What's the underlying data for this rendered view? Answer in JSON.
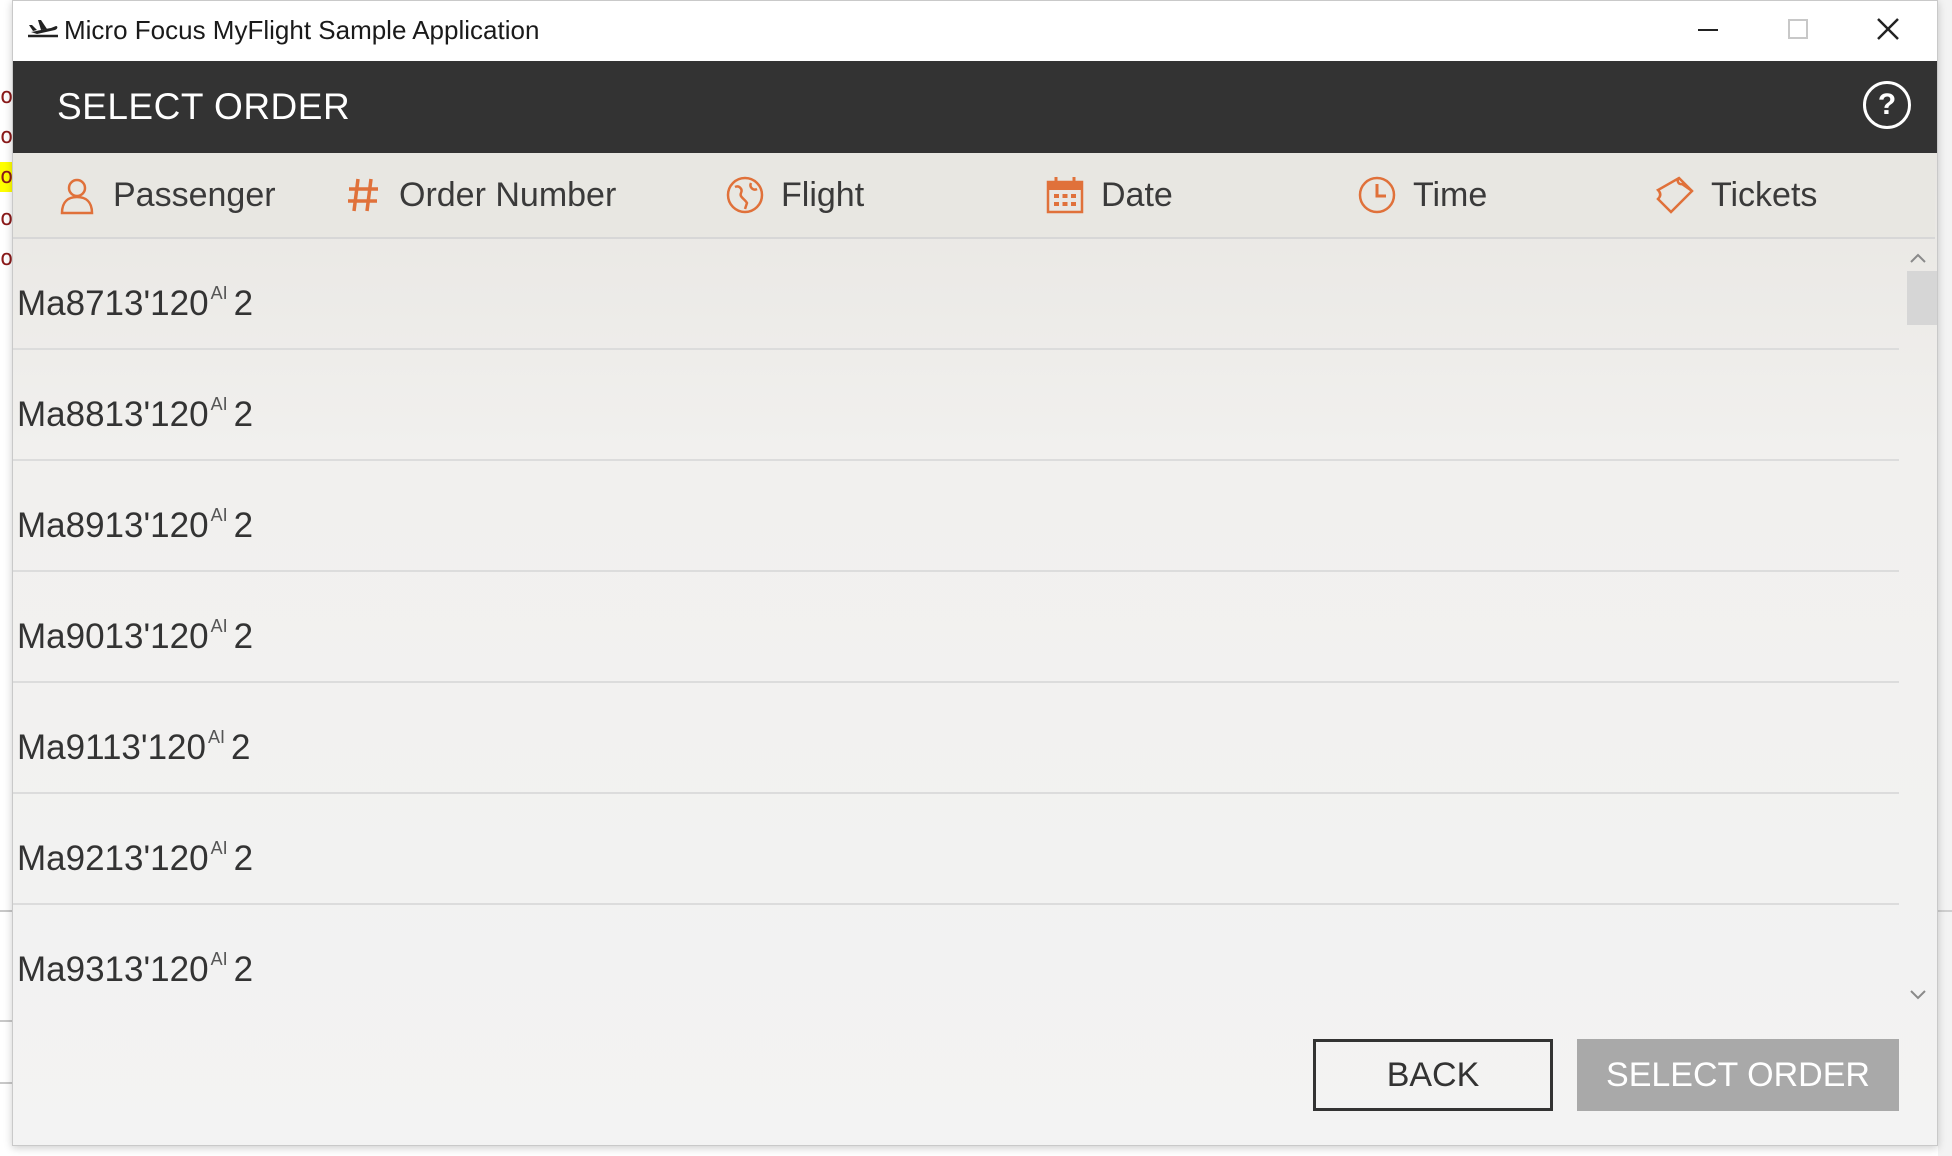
{
  "window": {
    "title": "Micro Focus MyFlight Sample Application"
  },
  "header": {
    "title": "SELECT ORDER",
    "help_label": "?"
  },
  "columns": [
    {
      "label": "Passenger",
      "icon": "person-icon"
    },
    {
      "label": "Order Number",
      "icon": "hash-icon"
    },
    {
      "label": "Flight",
      "icon": "globe-icon"
    },
    {
      "label": "Date",
      "icon": "calendar-icon"
    },
    {
      "label": "Time",
      "icon": "clock-icon"
    },
    {
      "label": "Tickets",
      "icon": "ticket-icon"
    }
  ],
  "rows": [
    {
      "main": "Ma8713'120",
      "sup": "AI",
      "tail": "2"
    },
    {
      "main": "Ma8813'120",
      "sup": "AI",
      "tail": "2"
    },
    {
      "main": "Ma8913'120",
      "sup": "AI",
      "tail": "2"
    },
    {
      "main": "Ma9013'120",
      "sup": "AI",
      "tail": "2"
    },
    {
      "main": "Ma9113'120",
      "sup": "AI",
      "tail": "2"
    },
    {
      "main": "Ma9213'120",
      "sup": "AI",
      "tail": "2"
    },
    {
      "main": "Ma9313'120",
      "sup": "AI",
      "tail": "2"
    }
  ],
  "buttons": {
    "back": "BACK",
    "select": "SELECT ORDER"
  },
  "background_chars": [
    "o",
    "o",
    "o",
    "o",
    "o"
  ],
  "colors": {
    "accent": "#e0713a",
    "header_bg": "#333333",
    "disabled_button": "#a9a9a9"
  }
}
